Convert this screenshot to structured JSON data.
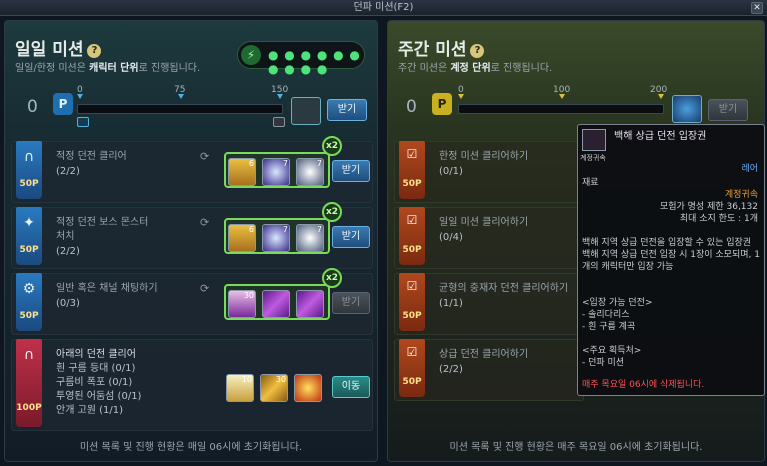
{
  "window": {
    "title": "던파 미션(F2)",
    "close_label": "✕"
  },
  "daily": {
    "title": "일일 미션",
    "desc_pre": "일일/한정 미션은 ",
    "desc_bold": "캐릭터 단위",
    "desc_post": "로 진행됩니다.",
    "points": "0",
    "point_icon": "P",
    "energy_dots": "● ● ● ● ● ● ● ● ● ●",
    "ticks": [
      "0",
      "75",
      "150"
    ],
    "claim_label": "받기",
    "missions": [
      {
        "name": "적정 던전 클리어",
        "progress": "(2/2)",
        "points": "50P",
        "button": "받기",
        "button_state": "active",
        "multiplier": "x2",
        "items": [
          {
            "count": "6"
          },
          {
            "count": "7"
          },
          {
            "count": "7"
          }
        ]
      },
      {
        "name": "적정 던전 보스 몬스터\n처치",
        "progress": "(2/2)",
        "points": "50P",
        "button": "받기",
        "button_state": "active",
        "multiplier": "x2",
        "items": [
          {
            "count": "6"
          },
          {
            "count": "7"
          },
          {
            "count": "7"
          }
        ]
      },
      {
        "name": "일반 혹은 채널 채팅하기",
        "progress": "(0/3)",
        "points": "50P",
        "button": "받기",
        "button_state": "disabled",
        "multiplier": "x2",
        "items": [
          {
            "count": "30"
          },
          {
            "count": ""
          },
          {
            "count": ""
          }
        ]
      },
      {
        "name": "아래의 던전 클리어",
        "progress": "흰 구름 등대 (0/1)\n구름비 폭포 (0/1)\n투영된 어둠섬 (0/1)\n안개 고원 (1/1)",
        "points": "100P",
        "button": "이동",
        "button_state": "move",
        "items": [
          {
            "count": "10"
          },
          {
            "count": "30"
          },
          {
            "count": ""
          }
        ]
      }
    ],
    "footer": "미션 목록 및 진행 현황은 매일 06시에 초기화됩니다."
  },
  "weekly": {
    "title": "주간 미션",
    "desc_pre": "주간 미션은 ",
    "desc_bold": "계정 단위",
    "desc_post": "로 진행됩니다.",
    "points": "0",
    "point_icon": "P",
    "ticks": [
      "0",
      "100",
      "200"
    ],
    "claim_label": "받기",
    "missions": [
      {
        "name": "한정 미션 클리어하기",
        "progress": "(0/1)",
        "points": "50P"
      },
      {
        "name": "일일 미션 클리어하기",
        "progress": "(0/4)",
        "points": "50P"
      },
      {
        "name": "균형의 중재자 던전 클리어하기",
        "progress": "(1/1)",
        "points": "50P"
      },
      {
        "name": "상급 던전 클리어하기",
        "progress": "(2/2)",
        "points": "50P"
      }
    ],
    "footer": "미션 목록 및 진행 현황은 매주 목요일 06시에 초기화됩니다."
  },
  "tooltip": {
    "icon_label": "계정귀속",
    "title": "백해 상급 던전 입장권",
    "rarity": "레어",
    "category": "재료",
    "binding": "계정귀속",
    "req": "모험가 명성 제한 36,132",
    "max": "최대 소지 한도 : 1개",
    "desc": "백해 지역 상급 던전을 입장할 수 있는 입장권\n백해 지역 상급 던전 입장 시 1장이 소모되며, 1개의 캐릭터만 입장 가능",
    "dungeons_head": "<입장 가능 던전>",
    "dungeons": "- 솔리다리스\n- 흰 구름 계곡",
    "source_head": "<주요 획득처>",
    "source": "- 던파 미션",
    "expire": "매주 목요일 06시에 삭제됩니다."
  }
}
